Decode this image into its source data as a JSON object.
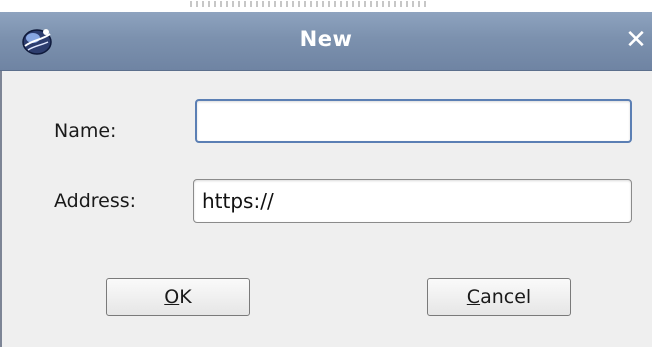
{
  "dialog": {
    "title": "New"
  },
  "form": {
    "name_label": "Name:",
    "name_value": "",
    "address_label": "Address:",
    "address_value": "https://"
  },
  "buttons": {
    "ok": {
      "mnemonic": "O",
      "rest": "K"
    },
    "cancel": {
      "mnemonic": "C",
      "rest": "ancel"
    }
  },
  "colors": {
    "titlebar": "#7c91ae",
    "dialog_bg": "#efefef",
    "focus_border": "#5b7fb4"
  },
  "icons": {
    "app": "application-globe-icon",
    "close": "close-icon"
  }
}
